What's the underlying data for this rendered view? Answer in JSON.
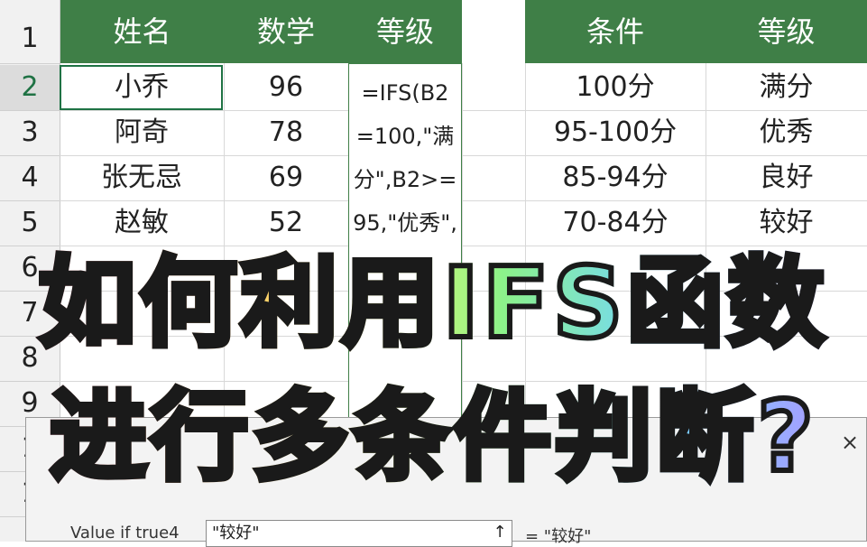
{
  "left_table": {
    "headers": [
      "姓名",
      "数学",
      "等级"
    ],
    "rows": [
      {
        "name": "小乔",
        "score": "96"
      },
      {
        "name": "阿奇",
        "score": "78"
      },
      {
        "name": "张无忌",
        "score": "69"
      },
      {
        "name": "赵敏",
        "score": "52"
      }
    ]
  },
  "formula_text": "=IFS(B2=100,\"满分\",B2>=95,\"优秀\",",
  "right_table": {
    "headers": [
      "条件",
      "等级"
    ],
    "rows": [
      {
        "cond": "100分",
        "grade": "满分"
      },
      {
        "cond": "95-100分",
        "grade": "优秀"
      },
      {
        "cond": "85-94分",
        "grade": "良好"
      },
      {
        "cond": "70-84分",
        "grade": "较好"
      }
    ]
  },
  "row_numbers": [
    "1",
    "2",
    "3",
    "4",
    "5",
    "6",
    "7",
    "8",
    "9",
    "1",
    "1"
  ],
  "dialog": {
    "arg_label": "Value if true4",
    "arg_value": "\"较好\"",
    "arg_result": "=  \"较好\"",
    "ref_icon": "↑",
    "close_icon": "×"
  },
  "overlay": {
    "line1": "如何利用IFS函数",
    "line2": "进行多条件判断?"
  },
  "colors": {
    "header_green": "#3f7f47",
    "selection_green": "#1f7244"
  }
}
